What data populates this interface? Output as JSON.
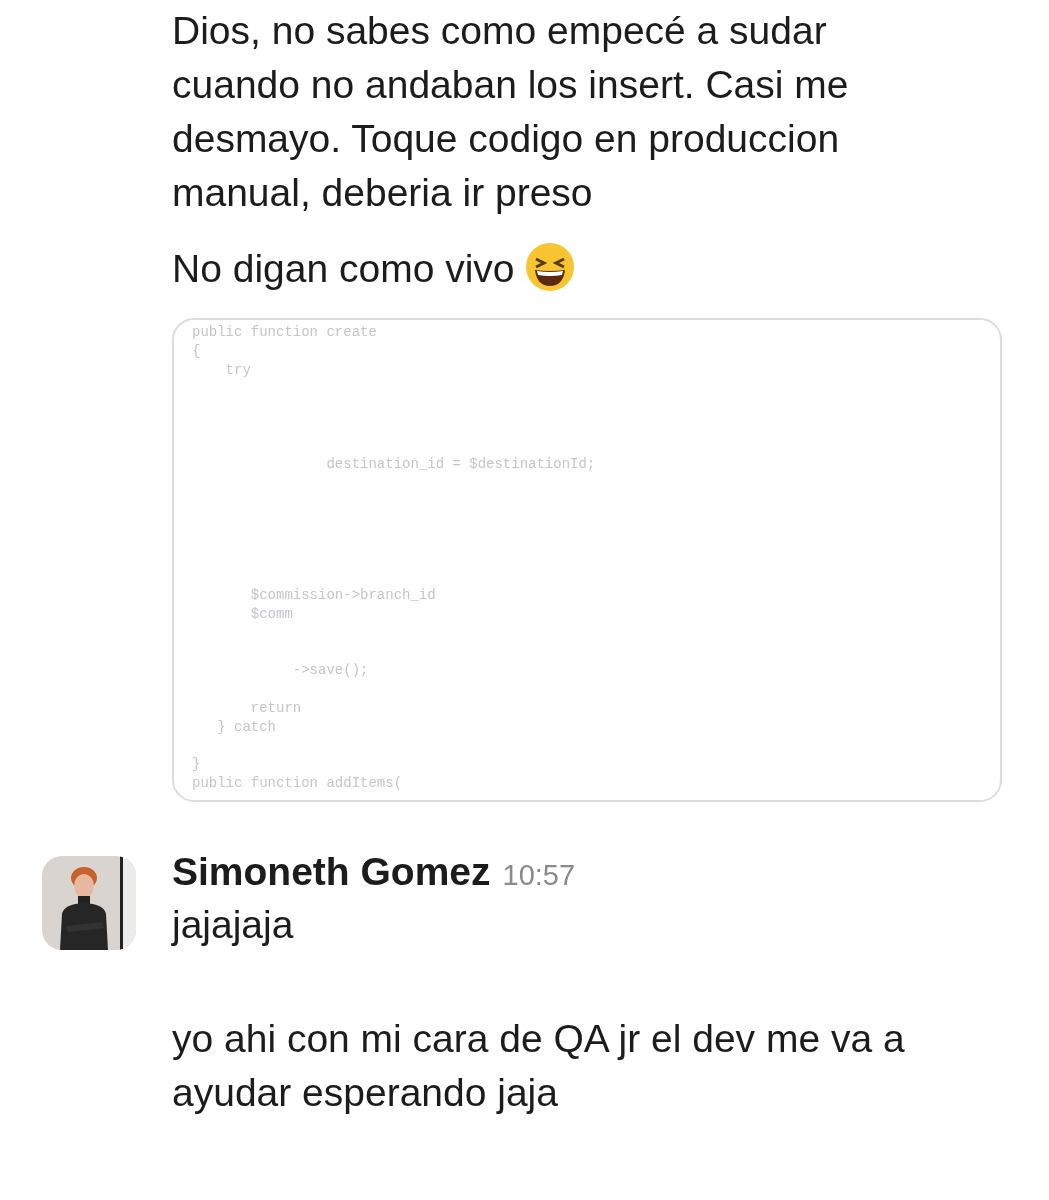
{
  "messages": [
    {
      "paragraphs": [
        {
          "kind": "text",
          "text": "Dios, no sabes como empecé a sudar cuando no andaban los insert. Casi me desmayo. Toque codigo en produccion manual, deberia ir preso"
        },
        {
          "kind": "text_with_emoji",
          "text": "No digan como vivo"
        }
      ],
      "attachment": {
        "kind": "code",
        "lines": [
          "public function create",
          "{",
          "    try",
          "                destination_id = $destinationId;",
          "       $commission->branch_id",
          "       $comm",
          "            ->save();",
          "       return",
          "   } catch",
          "}",
          "public function addItems("
        ]
      }
    },
    {
      "author": "Simoneth Gomez",
      "time": "10:57",
      "paragraphs": [
        {
          "kind": "text",
          "text": "jajajaja"
        },
        {
          "kind": "text",
          "text": "yo ahi con mi cara de QA jr el dev me va a ayudar esperando jaja"
        }
      ]
    }
  ]
}
